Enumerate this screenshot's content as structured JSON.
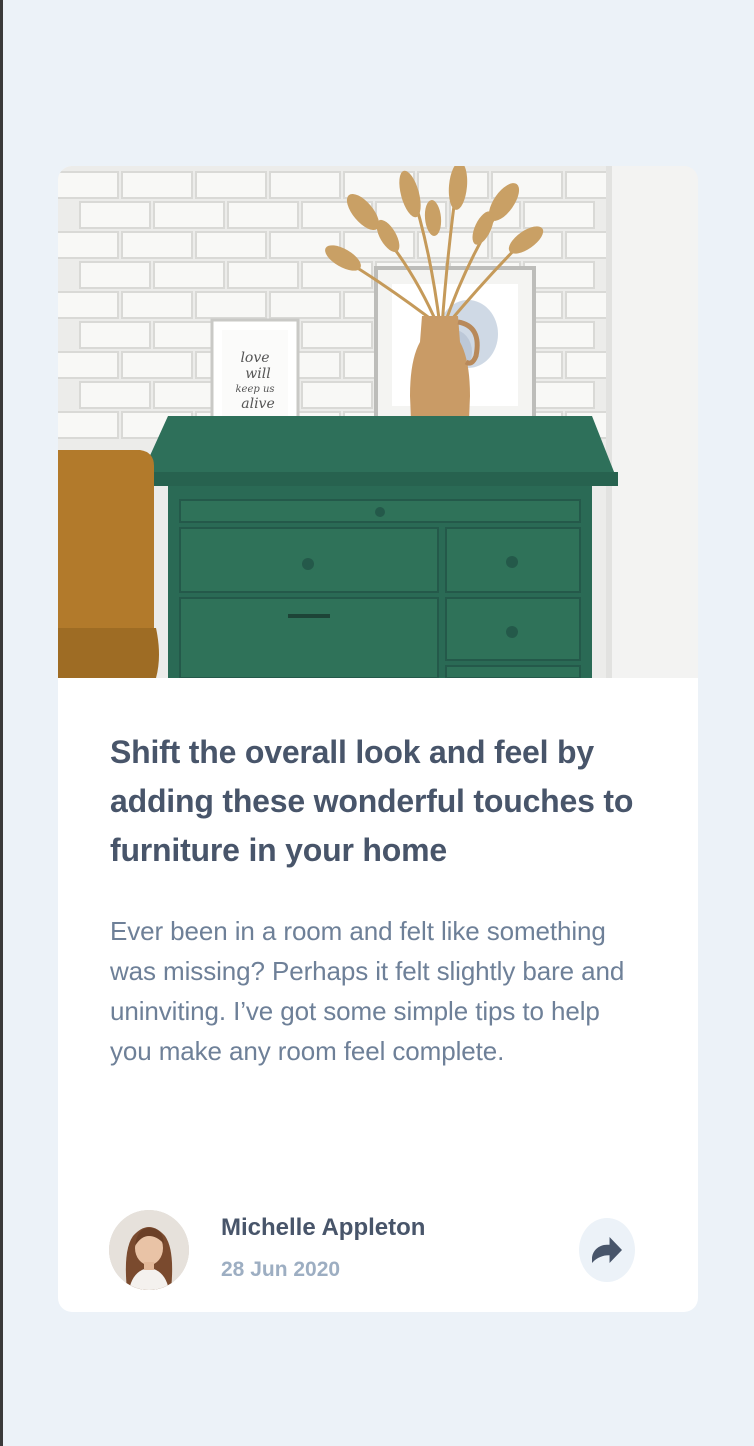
{
  "article": {
    "image_alt": "Green drawer cabinet with vase and picture frames",
    "frame_text": "love will keep us alive",
    "title": "Shift the overall look and feel by adding these wonderful touches to furniture in your home",
    "excerpt": "Ever been in a room and felt like something was missing? Perhaps it felt slightly bare and uninviting. I’ve got some simple tips to help you make any room feel complete."
  },
  "author": {
    "name": "Michelle Appleton",
    "date": "28 Jun 2020",
    "avatar_icon": "avatar-photo"
  },
  "share": {
    "icon": "share-icon"
  },
  "colors": {
    "background": "#ECF2F8",
    "card": "#FFFFFF",
    "title": "#48556A",
    "text": "#6E8098",
    "muted": "#9DAEC2",
    "cabinet": "#2F7259"
  }
}
